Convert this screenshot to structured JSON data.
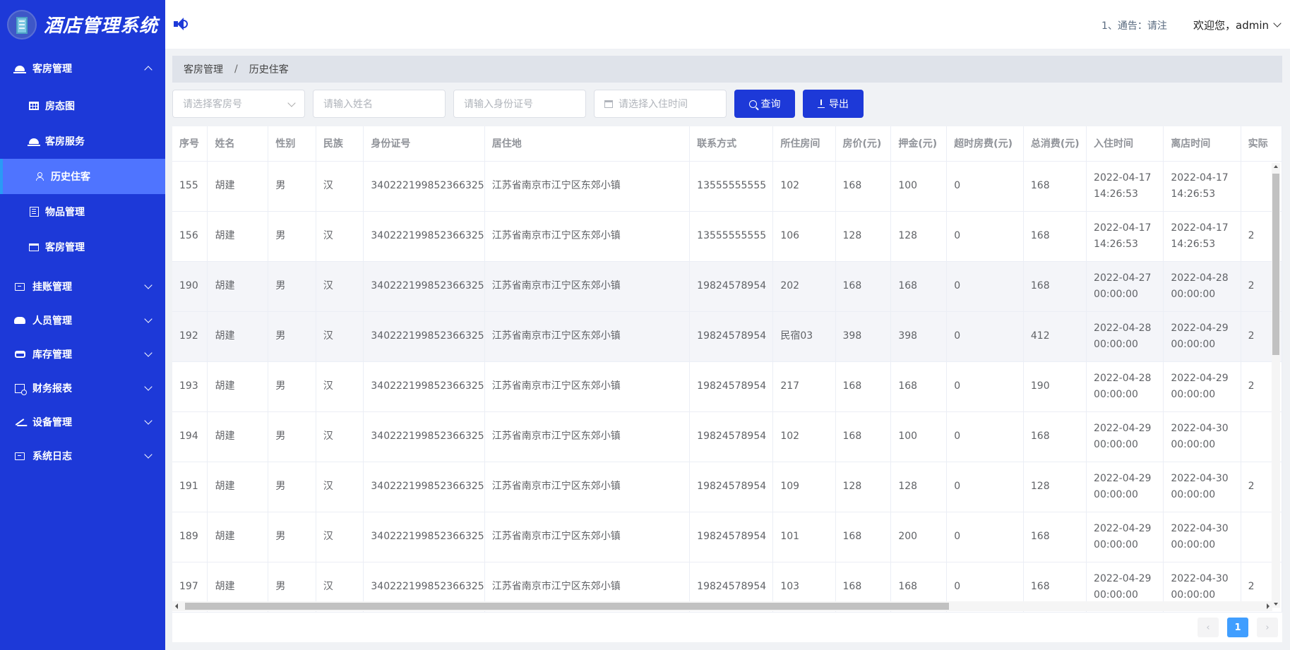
{
  "app": {
    "title": "酒店管理系统"
  },
  "header": {
    "notice": "1、通告：请注",
    "welcome": "欢迎您，admin"
  },
  "sidebar": {
    "groups": [
      {
        "label": "客房管理",
        "icon": "bell-icon",
        "expanded": true,
        "items": [
          {
            "label": "房态图",
            "icon": "grid-icon"
          },
          {
            "label": "客房服务",
            "icon": "bell-icon"
          },
          {
            "label": "历史住客",
            "icon": "person-icon",
            "active": true
          },
          {
            "label": "物品管理",
            "icon": "building-icon"
          },
          {
            "label": "客房管理",
            "icon": "bed-icon"
          }
        ]
      },
      {
        "label": "挂账管理",
        "icon": "box-icon"
      },
      {
        "label": "人员管理",
        "icon": "people-icon"
      },
      {
        "label": "库存管理",
        "icon": "sofa-icon"
      },
      {
        "label": "财务报表",
        "icon": "report-icon"
      },
      {
        "label": "设备管理",
        "icon": "pen-icon"
      },
      {
        "label": "系统日志",
        "icon": "box-icon"
      }
    ]
  },
  "breadcrumb": {
    "root": "客房管理",
    "sep": "/",
    "current": "历史住客"
  },
  "filters": {
    "room_placeholder": "请选择客房号",
    "name_placeholder": "请输入姓名",
    "id_placeholder": "请输入身份证号",
    "date_placeholder": "请选择入住时间",
    "query_label": "查询",
    "export_label": "导出"
  },
  "table": {
    "headers": [
      "序号",
      "姓名",
      "性别",
      "民族",
      "身份证号",
      "居住地",
      "联系方式",
      "所住房间",
      "房价(元)",
      "押金(元)",
      "超时房费(元)",
      "总消费(元)",
      "入住时间",
      "离店时间",
      "实际"
    ],
    "rows": [
      [
        "155",
        "胡建",
        "男",
        "汉",
        "340222199852366325",
        "江苏省南京市江宁区东郊小镇",
        "13555555555",
        "102",
        "168",
        "100",
        "0",
        "168",
        "2022-04-17 14:26:53",
        "2022-04-17 14:26:53",
        ""
      ],
      [
        "156",
        "胡建",
        "男",
        "汉",
        "340222199852366325",
        "江苏省南京市江宁区东郊小镇",
        "13555555555",
        "106",
        "128",
        "128",
        "0",
        "168",
        "2022-04-17 14:26:53",
        "2022-04-17 14:26:53",
        "2"
      ],
      [
        "190",
        "胡建",
        "男",
        "汉",
        "340222199852366325",
        "江苏省南京市江宁区东郊小镇",
        "19824578954",
        "202",
        "168",
        "168",
        "0",
        "168",
        "2022-04-27 00:00:00",
        "2022-04-28 00:00:00",
        "2"
      ],
      [
        "192",
        "胡建",
        "男",
        "汉",
        "340222199852366325",
        "江苏省南京市江宁区东郊小镇",
        "19824578954",
        "民宿03",
        "398",
        "398",
        "0",
        "412",
        "2022-04-28 00:00:00",
        "2022-04-29 00:00:00",
        "2"
      ],
      [
        "193",
        "胡建",
        "男",
        "汉",
        "340222199852366325",
        "江苏省南京市江宁区东郊小镇",
        "19824578954",
        "217",
        "168",
        "168",
        "0",
        "190",
        "2022-04-28 00:00:00",
        "2022-04-29 00:00:00",
        "2"
      ],
      [
        "194",
        "胡建",
        "男",
        "汉",
        "340222199852366325",
        "江苏省南京市江宁区东郊小镇",
        "19824578954",
        "102",
        "168",
        "100",
        "0",
        "168",
        "2022-04-29 00:00:00",
        "2022-04-30 00:00:00",
        ""
      ],
      [
        "191",
        "胡建",
        "男",
        "汉",
        "340222199852366325",
        "江苏省南京市江宁区东郊小镇",
        "19824578954",
        "109",
        "128",
        "128",
        "0",
        "128",
        "2022-04-29 00:00:00",
        "2022-04-30 00:00:00",
        "2"
      ],
      [
        "189",
        "胡建",
        "男",
        "汉",
        "340222199852366325",
        "江苏省南京市江宁区东郊小镇",
        "19824578954",
        "101",
        "168",
        "200",
        "0",
        "168",
        "2022-04-29 00:00:00",
        "2022-04-30 00:00:00",
        ""
      ],
      [
        "197",
        "胡建",
        "男",
        "汉",
        "340222199852366325",
        "江苏省南京市江宁区东郊小镇",
        "19824578954",
        "103",
        "168",
        "168",
        "0",
        "168",
        "2022-04-29 00:00:00",
        "2022-04-30 00:00:00",
        "2"
      ]
    ],
    "striped_rows": [
      2,
      3
    ]
  },
  "pagination": {
    "prev": "‹",
    "current_page": "1",
    "next": "›"
  },
  "colors": {
    "sidebar_bg": "#1d39d8",
    "accent": "#1d39d8",
    "active_item": "#4f74ff",
    "page_active": "#409eff"
  }
}
